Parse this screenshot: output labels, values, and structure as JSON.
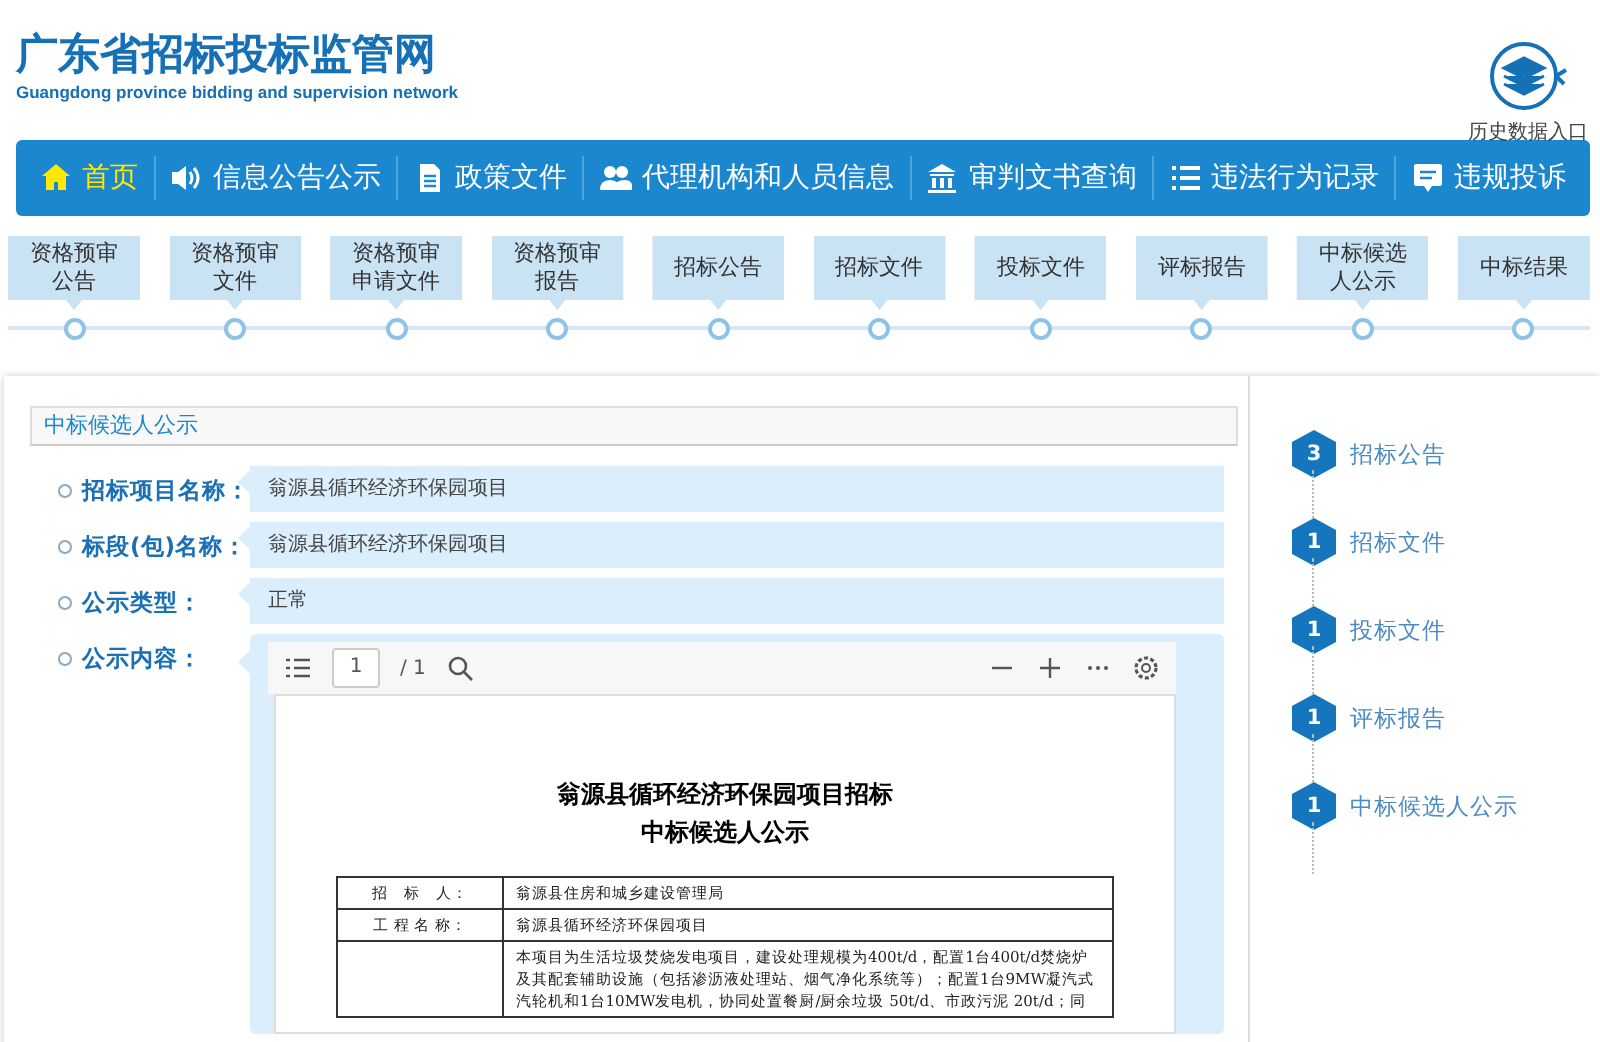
{
  "header": {
    "title": "广东省招标投标监管网",
    "subtitle": "Guangdong province bidding and supervision network",
    "history_link": "历史数据入口"
  },
  "nav": [
    {
      "label": "首页",
      "selected": true
    },
    {
      "label": "信息公告公示",
      "selected": false
    },
    {
      "label": "政策文件",
      "selected": false
    },
    {
      "label": "代理机构和人员信息",
      "selected": false
    },
    {
      "label": "审判文书查询",
      "selected": false
    },
    {
      "label": "违法行为记录",
      "selected": false
    },
    {
      "label": "违规投诉",
      "selected": false
    }
  ],
  "steps": [
    "资格预审公告",
    "资格预审文件",
    "资格预审申请文件",
    "资格预审报告",
    "招标公告",
    "招标文件",
    "投标文件",
    "评标报告",
    "中标候选人公示",
    "中标结果"
  ],
  "panel": {
    "title": "中标候选人公示",
    "fields": [
      {
        "label": "招标项目名称：",
        "value": "翁源县循环经济环保园项目"
      },
      {
        "label": "标段(包)名称：",
        "value": "翁源县循环经济环保园项目"
      },
      {
        "label": "公示类型：",
        "value": "正常"
      }
    ],
    "content_label": "公示内容：",
    "viewer": {
      "page": "1",
      "page_total": "/ 1",
      "document": {
        "title_lines": [
          "翁源县循环经济环保园项目招标",
          "中标候选人公示"
        ],
        "rows": [
          {
            "label": "招　标　人：",
            "value": "翁源县住房和城乡建设管理局"
          },
          {
            "label": "工 程 名 称：",
            "value": "翁源县循环经济环保园项目"
          },
          {
            "value": "本项目为生活垃圾焚烧发电项目，建设处理规模为400t/d，配置1台400t/d焚烧炉及其配套辅助设施（包括渗沥液处理站、烟气净化系统等）；配置1台9MW凝汽式汽轮机和1台10MW发电机，协同处置餐厨/厨余垃圾 50t/d、市政污泥 20t/d；同"
          }
        ]
      }
    }
  },
  "sidebar": [
    {
      "count": "3",
      "label": "招标公告"
    },
    {
      "count": "1",
      "label": "招标文件"
    },
    {
      "count": "1",
      "label": "投标文件"
    },
    {
      "count": "1",
      "label": "评标报告"
    },
    {
      "count": "1",
      "label": "中标候选人公示"
    }
  ]
}
